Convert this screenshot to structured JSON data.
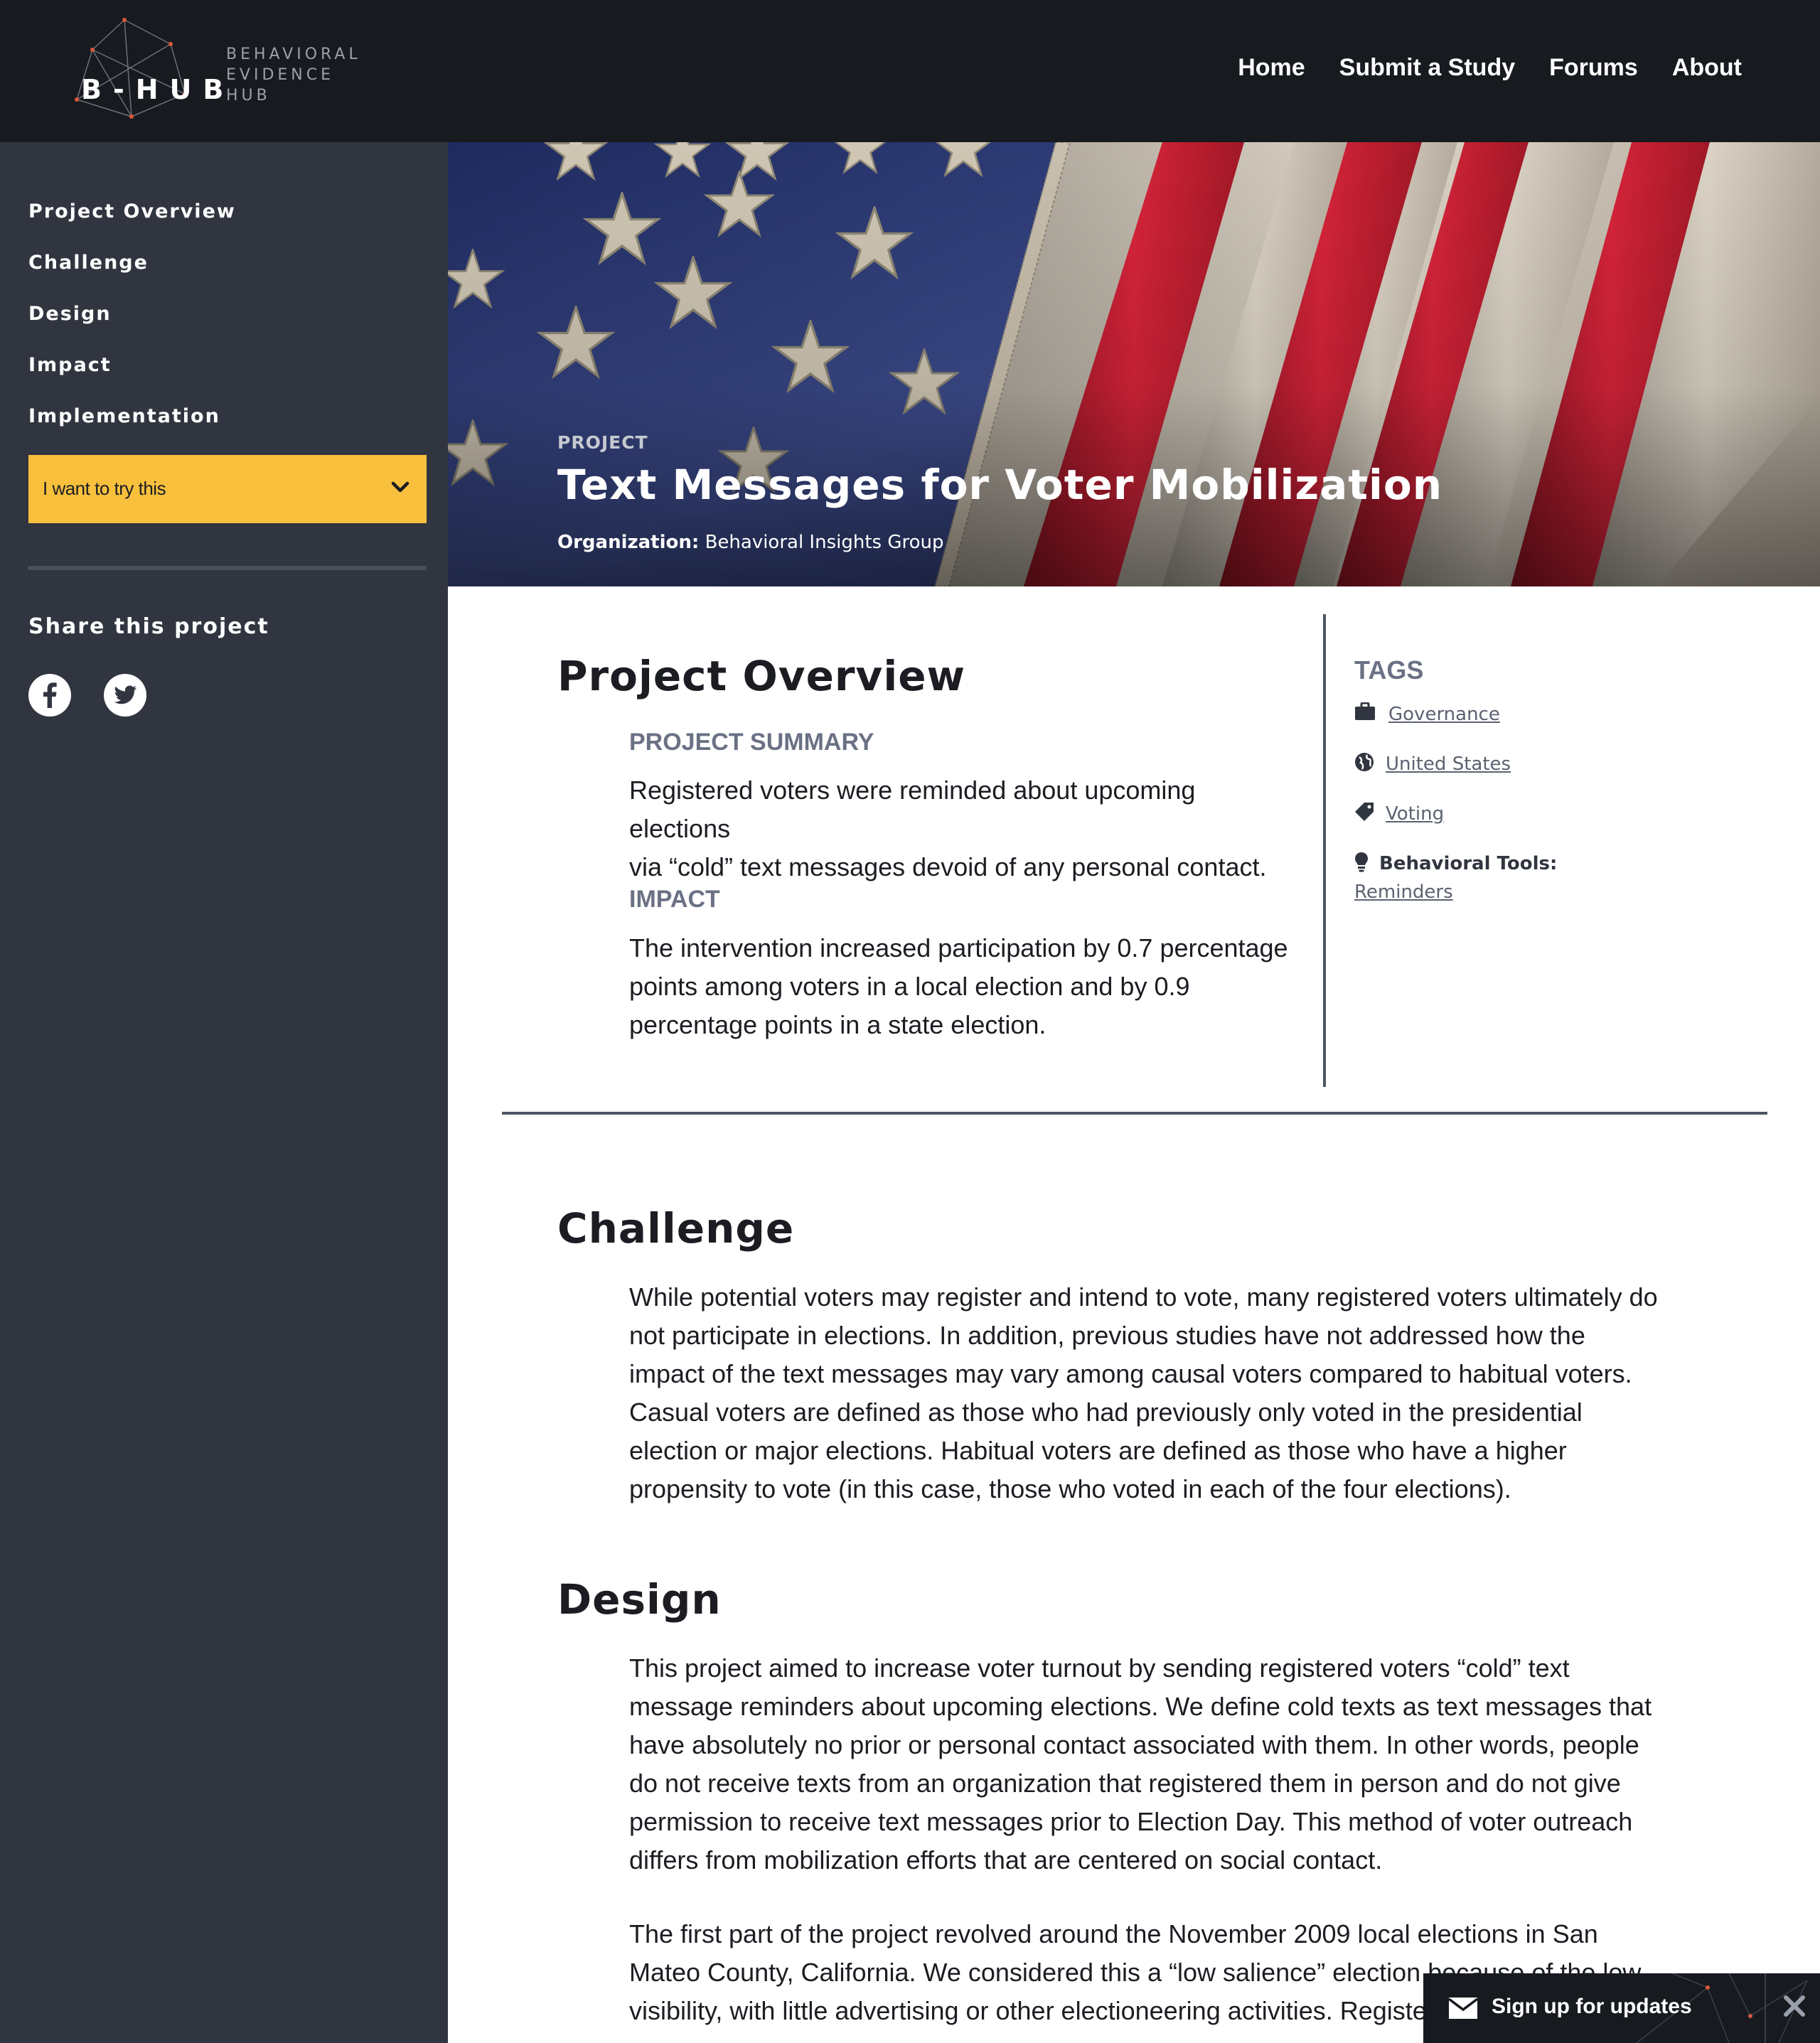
{
  "header": {
    "logo_mark": "B-HUB",
    "logo_text": [
      "BEHAVIORAL",
      "EVIDENCE",
      "HUB"
    ],
    "nav": [
      "Home",
      "Submit a Study",
      "Forums",
      "About"
    ]
  },
  "sidebar": {
    "nav": [
      "Project Overview",
      "Challenge",
      "Design",
      "Impact",
      "Implementation"
    ],
    "cta_label": "I want to try this",
    "share_title": "Share this project",
    "social_icons": [
      "facebook-icon",
      "twitter-icon"
    ]
  },
  "hero": {
    "label": "PROJECT",
    "title": "Text Messages for Voter Mobilization",
    "org_label": "Organization:",
    "org_value": "Behavioral Insights Group"
  },
  "overview": {
    "title": "Project Overview",
    "summary_title": "PROJECT SUMMARY",
    "summary_lines": [
      "Registered voters were reminded about upcoming elections",
      "via “cold” text messages devoid of any personal contact."
    ],
    "impact_title": "IMPACT",
    "impact_lines": [
      "The intervention increased participation by 0.7 percentage",
      "points among voters in a local election and by 0.9",
      "percentage points in a state election."
    ]
  },
  "tags": {
    "title": "TAGS",
    "governance": "Governance",
    "country": "United States",
    "topic": "Voting",
    "tools_label": "Behavioral Tools:",
    "tools_value": "Reminders"
  },
  "challenge": {
    "title": "Challenge",
    "lines": [
      "While potential voters may register and intend to vote, many registered voters ultimately do",
      "not participate in elections. In addition, previous studies have not addressed how the",
      "impact of the text messages may vary among causal voters compared to habitual voters.",
      "Casual voters are defined as those who had previously only voted in the presidential",
      "election or major elections. Habitual voters are defined as those who have a higher",
      "propensity to vote (in this case, those who voted in each of the four elections)."
    ]
  },
  "design": {
    "title": "Design",
    "p1_lines": [
      "This project aimed to increase voter turnout by sending registered voters “cold” text",
      "message reminders about upcoming elections. We define cold texts as text messages that",
      "have absolutely no prior or personal contact associated with them. In other words, people",
      "do not receive texts from an organization that registered them in person and do not give",
      "permission to receive text messages prior to Election Day. This method of voter outreach",
      "differs from mobilization efforts that are centered on social contact."
    ],
    "p2_lines": [
      "The first part of the project revolved around the November 2009 local elections in San",
      "Mateo County, California. We considered this a “low salience” election because of the low",
      "visibility, with little advertising or other electioneering activities. Registe"
    ]
  },
  "signup": {
    "label": "Sign up for updates"
  },
  "colors": {
    "header_bg": "#171a1f",
    "sidebar_bg": "#31353f",
    "cta_yellow": "#f8c03d",
    "heading_gray": "#6a7184"
  }
}
